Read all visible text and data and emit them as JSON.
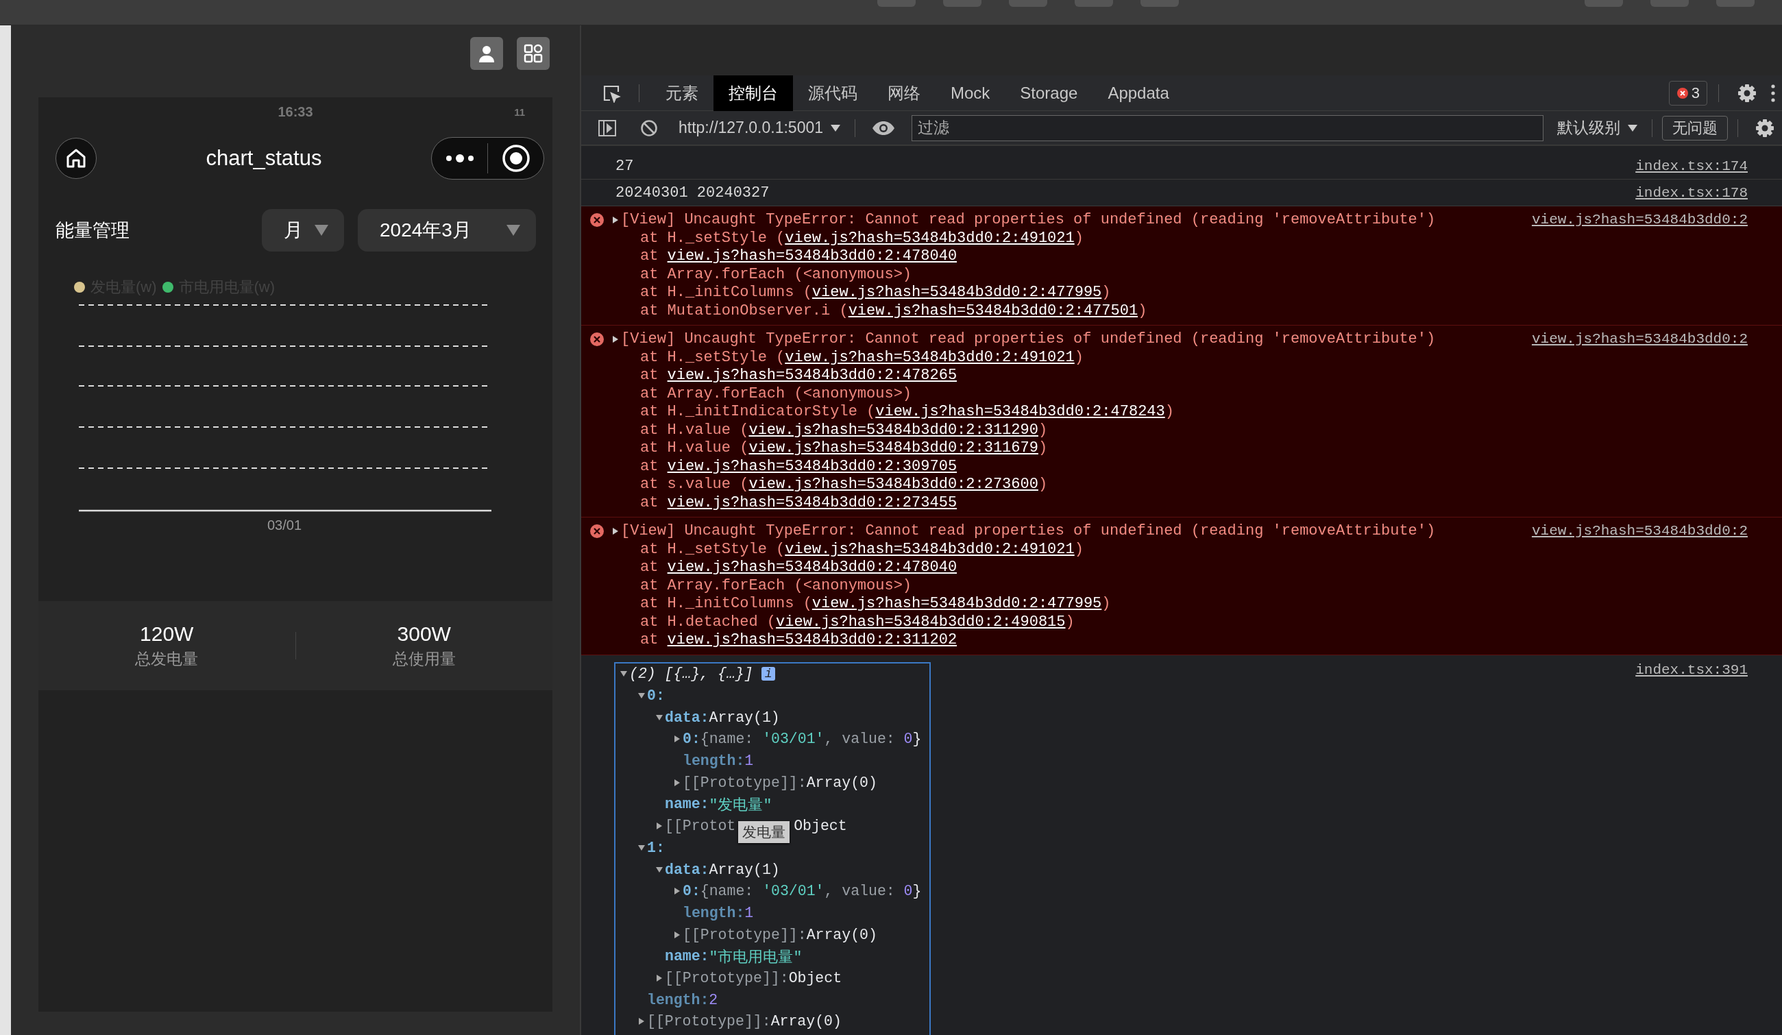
{
  "phone": {
    "status_bar": {
      "time": "16:33",
      "indicator": "11"
    },
    "nav": {
      "title": "chart_status"
    },
    "header": {
      "title": "能量管理",
      "period": "月",
      "month": "2024年3月"
    },
    "chart": {
      "legend": [
        {
          "label": "发电量(w)",
          "color": "#d8c48e"
        },
        {
          "label": "市电用电量(w)",
          "color": "#3fba6c"
        }
      ],
      "x_label": "03/01"
    },
    "stats": [
      {
        "value": "120W",
        "label": "总发电量"
      },
      {
        "value": "300W",
        "label": "总使用量"
      }
    ]
  },
  "devtools": {
    "tabs": [
      {
        "label": "元素",
        "selected": false
      },
      {
        "label": "控制台",
        "selected": true
      },
      {
        "label": "源代码",
        "selected": false
      },
      {
        "label": "网络",
        "selected": false
      },
      {
        "label": "Mock",
        "selected": false
      },
      {
        "label": "Storage",
        "selected": false
      },
      {
        "label": "Appdata",
        "selected": false
      }
    ],
    "error_count": "3",
    "context": "http://127.0.0.1:5001",
    "filter": {
      "placeholder": "过滤"
    },
    "level": "默认级别",
    "issues": "无问题"
  },
  "console": {
    "messages": [
      {
        "kind": "log",
        "text": "27",
        "source": "index.tsx:174"
      },
      {
        "kind": "log",
        "text": "20240301 20240327",
        "source": "index.tsx:178"
      },
      {
        "kind": "error",
        "expanded": false,
        "text": "[View] Uncaught TypeError: Cannot read properties of undefined (reading 'removeAttribute')",
        "source": "view.js?hash=53484b3dd0:2",
        "frames": [
          {
            "before": "at H._setStyle (",
            "link": "view.js?hash=53484b3dd0:2:491021",
            "after": ")"
          },
          {
            "before": "at ",
            "link": "view.js?hash=53484b3dd0:2:478040"
          },
          {
            "before": "at Array.forEach (<anonymous>)"
          },
          {
            "before": "at H._initColumns (",
            "link": "view.js?hash=53484b3dd0:2:477995",
            "after": ")"
          },
          {
            "before": "at MutationObserver.i (",
            "link": "view.js?hash=53484b3dd0:2:477501",
            "after": ")"
          }
        ]
      },
      {
        "kind": "error",
        "expanded": false,
        "text": "[View] Uncaught TypeError: Cannot read properties of undefined (reading 'removeAttribute')",
        "source": "view.js?hash=53484b3dd0:2",
        "frames": [
          {
            "before": "at H._setStyle (",
            "link": "view.js?hash=53484b3dd0:2:491021",
            "after": ")"
          },
          {
            "before": "at ",
            "link": "view.js?hash=53484b3dd0:2:478265"
          },
          {
            "before": "at Array.forEach (<anonymous>)"
          },
          {
            "before": "at H._initIndicatorStyle (",
            "link": "view.js?hash=53484b3dd0:2:478243",
            "after": ")"
          },
          {
            "before": "at H.value (",
            "link": "view.js?hash=53484b3dd0:2:311290",
            "after": ")"
          },
          {
            "before": "at H.value (",
            "link": "view.js?hash=53484b3dd0:2:311679",
            "after": ")"
          },
          {
            "before": "at ",
            "link": "view.js?hash=53484b3dd0:2:309705"
          },
          {
            "before": "at s.value (",
            "link": "view.js?hash=53484b3dd0:2:273600",
            "after": ")"
          },
          {
            "before": "at ",
            "link": "view.js?hash=53484b3dd0:2:273455"
          }
        ]
      },
      {
        "kind": "error",
        "expanded": false,
        "text": "[View] Uncaught TypeError: Cannot read properties of undefined (reading 'removeAttribute')",
        "source": "view.js?hash=53484b3dd0:2",
        "frames": [
          {
            "before": "at H._setStyle (",
            "link": "view.js?hash=53484b3dd0:2:491021",
            "after": ")"
          },
          {
            "before": "at ",
            "link": "view.js?hash=53484b3dd0:2:478040"
          },
          {
            "before": "at Array.forEach (<anonymous>)"
          },
          {
            "before": "at H._initColumns (",
            "link": "view.js?hash=53484b3dd0:2:477995",
            "after": ")"
          },
          {
            "before": "at H.detached (",
            "link": "view.js?hash=53484b3dd0:2:490815",
            "after": ")"
          },
          {
            "before": "at ",
            "link": "view.js?hash=53484b3dd0:2:311202"
          }
        ]
      },
      {
        "kind": "object",
        "expanded": true,
        "summary": "(2) [{…}, {…}]",
        "info_badge": "i",
        "source": "index.tsx:391",
        "children": [
          {
            "key": "0:",
            "kind": "index",
            "expanded": true,
            "children": [
              {
                "key": "data:",
                "kind": "prop",
                "expanded": true,
                "value": [
                  {
                    "text": "Array(1)",
                    "kind": "plain"
                  }
                ],
                "children": [
                  {
                    "key": "0:",
                    "kind": "index",
                    "expanded": false,
                    "value": [
                      {
                        "text": "{name: ",
                        "kind": "dim"
                      },
                      {
                        "text": "'03/01'",
                        "kind": "string"
                      },
                      {
                        "text": ", value: ",
                        "kind": "dim"
                      },
                      {
                        "text": "0",
                        "kind": "number"
                      },
                      {
                        "text": "}",
                        "kind": "plain"
                      }
                    ]
                  },
                  {
                    "key": "length:",
                    "kind": "meta",
                    "value": [
                      {
                        "text": "1",
                        "kind": "number"
                      }
                    ]
                  },
                  {
                    "key": "[[Prototype]]:",
                    "kind": "proto",
                    "expanded": false,
                    "value": [
                      {
                        "text": "Array(0)",
                        "kind": "plain"
                      }
                    ]
                  }
                ]
              },
              {
                "key": "name:",
                "kind": "prop",
                "value": [
                  {
                    "text": "\"发电量\"",
                    "kind": "string"
                  }
                ]
              },
              {
                "key": "[[Protot",
                "kind": "proto",
                "expanded": false,
                "tooltip": "发电量",
                "value": [
                  {
                    "text": "Object",
                    "kind": "plain"
                  }
                ]
              }
            ]
          },
          {
            "key": "1:",
            "kind": "index",
            "expanded": true,
            "children": [
              {
                "key": "data:",
                "kind": "prop",
                "expanded": true,
                "value": [
                  {
                    "text": "Array(1)",
                    "kind": "plain"
                  }
                ],
                "children": [
                  {
                    "key": "0:",
                    "kind": "index",
                    "expanded": false,
                    "value": [
                      {
                        "text": "{name: ",
                        "kind": "dim"
                      },
                      {
                        "text": "'03/01'",
                        "kind": "string"
                      },
                      {
                        "text": ", value: ",
                        "kind": "dim"
                      },
                      {
                        "text": "0",
                        "kind": "number"
                      },
                      {
                        "text": "}",
                        "kind": "plain"
                      }
                    ]
                  },
                  {
                    "key": "length:",
                    "kind": "meta",
                    "value": [
                      {
                        "text": "1",
                        "kind": "number"
                      }
                    ]
                  },
                  {
                    "key": "[[Prototype]]:",
                    "kind": "proto",
                    "expanded": false,
                    "value": [
                      {
                        "text": "Array(0)",
                        "kind": "plain"
                      }
                    ]
                  }
                ]
              },
              {
                "key": "name:",
                "kind": "prop",
                "value": [
                  {
                    "text": "\"市电用电量\"",
                    "kind": "string"
                  }
                ]
              },
              {
                "key": "[[Prototype]]:",
                "kind": "proto",
                "expanded": false,
                "value": [
                  {
                    "text": "Object",
                    "kind": "plain"
                  }
                ]
              }
            ]
          },
          {
            "key": "length:",
            "kind": "meta",
            "value": [
              {
                "text": "2",
                "kind": "number"
              }
            ]
          },
          {
            "key": "[[Prototype]]:",
            "kind": "proto",
            "expanded": false,
            "value": [
              {
                "text": "Array(0)",
                "kind": "plain"
              }
            ]
          }
        ]
      }
    ]
  }
}
